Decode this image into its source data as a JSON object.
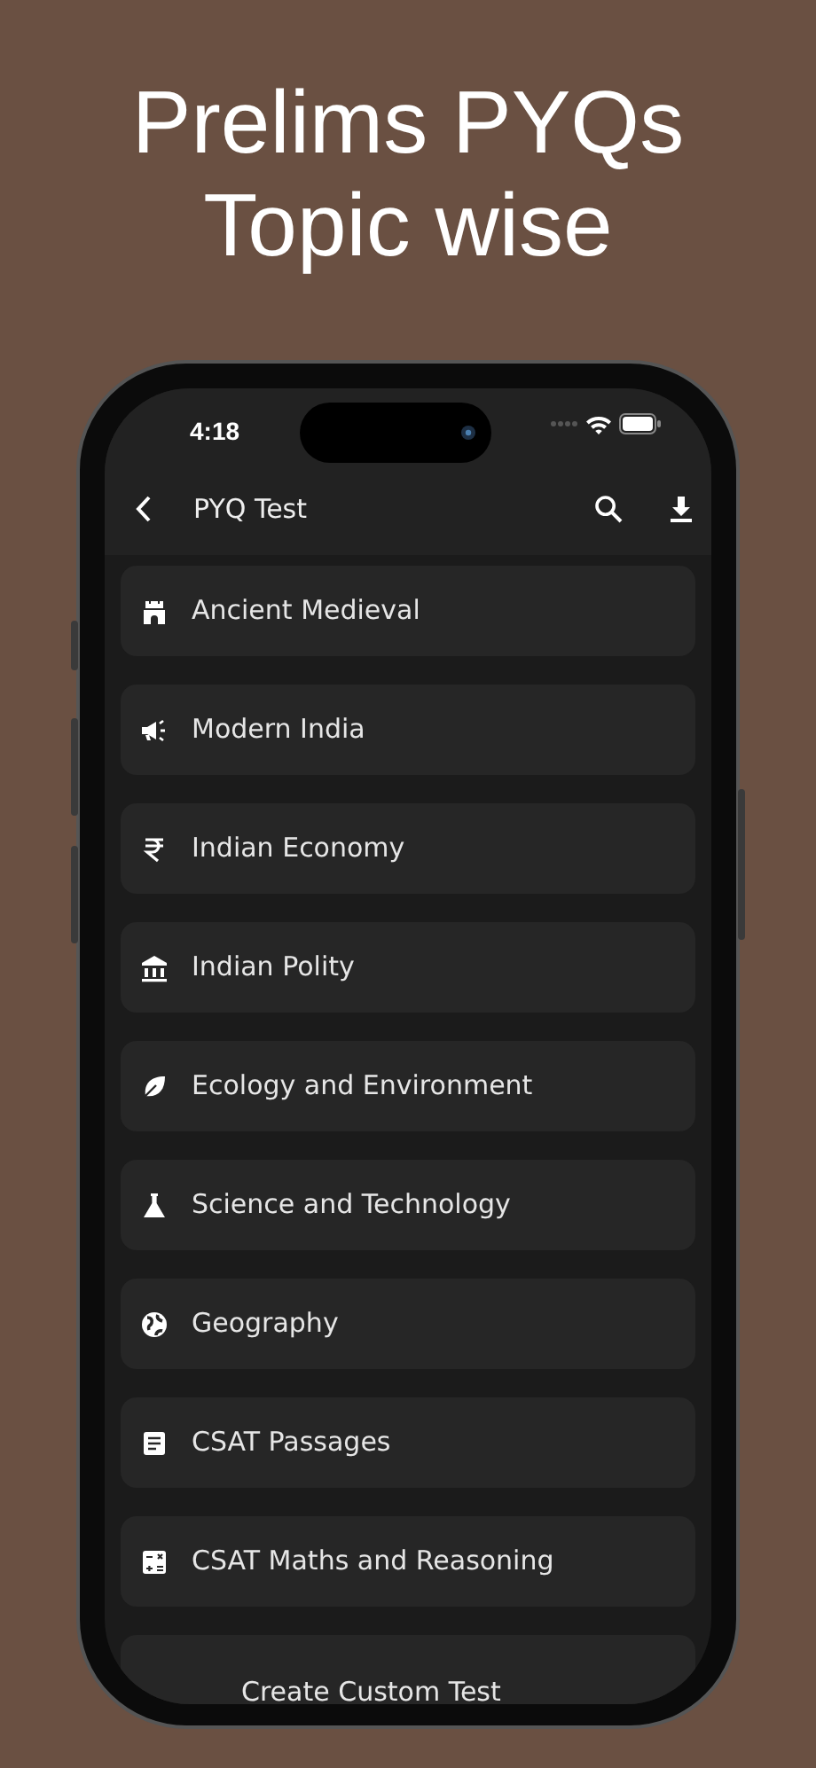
{
  "headline": [
    "Prelims PYQs",
    "Topic wise"
  ],
  "status_bar": {
    "time": "4:18"
  },
  "app_bar": {
    "title": "PYQ Test"
  },
  "topics": [
    {
      "label": "Ancient Medieval"
    },
    {
      "label": "Modern India"
    },
    {
      "label": "Indian Economy"
    },
    {
      "label": "Indian Polity"
    },
    {
      "label": "Ecology and Environment"
    },
    {
      "label": "Science and Technology"
    },
    {
      "label": "Geography"
    },
    {
      "label": "CSAT Passages"
    },
    {
      "label": "CSAT Maths and Reasoning"
    },
    {
      "label": "Create Custom Test"
    }
  ]
}
